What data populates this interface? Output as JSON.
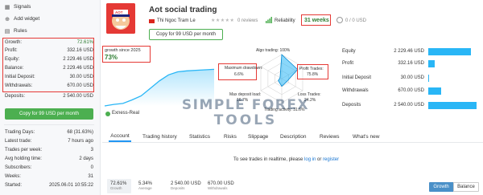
{
  "sidebar": {
    "nav": [
      {
        "label": "Signals",
        "icon": "signal-icon"
      },
      {
        "label": "Add widget",
        "icon": "plus-icon"
      },
      {
        "label": "Rules",
        "icon": "document-icon"
      }
    ],
    "stats": [
      {
        "label": "Growth:",
        "value": "72.61%",
        "color": "#2e7d32"
      },
      {
        "label": "Profit:",
        "value": "332.16 USD"
      },
      {
        "label": "Equity:",
        "value": "2 229.46 USD"
      },
      {
        "label": "Balance:",
        "value": "2 229.46 USD"
      },
      {
        "label": "Initial Deposit:",
        "value": "30.00 USD"
      },
      {
        "label": "Withdrawals:",
        "value": "670.00 USD"
      },
      {
        "label": "Deposits:",
        "value": "2 540.00 USD"
      }
    ],
    "copy_button": "Copy for 99 USD per month",
    "stats2": [
      {
        "label": "Trading Days:",
        "value": "68 (31.63%)"
      },
      {
        "label": "Latest trade:",
        "value": "7 hours ago"
      },
      {
        "label": "Trades per week:",
        "value": "3"
      },
      {
        "label": "Avg holding time:",
        "value": "2 days"
      },
      {
        "label": "Subscribers:",
        "value": "0"
      },
      {
        "label": "Weeks:",
        "value": "31"
      },
      {
        "label": "Started:",
        "value": "2025.06.01 10:55:22"
      }
    ]
  },
  "header": {
    "title": "Aot social trading",
    "author": "Thi Ngoc Tram Le",
    "reviews": "0 reviews",
    "reliability": "Reliability",
    "weeks": "31 weeks",
    "subscribers": "0 / 0 USD",
    "copy_button": "Copy for 99 USD per month",
    "avatar_text": "AOT"
  },
  "chart": {
    "growth_label": "growth since 2025",
    "growth_value": "73%",
    "broker": "Exness-Real",
    "chart_data": {
      "type": "line",
      "series": [
        {
          "values": [
            0,
            3,
            5,
            12,
            20,
            35,
            50,
            62,
            68,
            70,
            71,
            72,
            73
          ]
        }
      ]
    }
  },
  "radar": {
    "algo": "Algo trading: 100%",
    "profit_trades_label": "Profit Trades:",
    "profit_trades_value": "75.8%",
    "loss_trades_label": "Loss Trades:",
    "loss_trades_value": "24.2%",
    "max_drawdown_label": "Maximum drawdown:",
    "max_drawdown_value": "6.6%",
    "max_deposit_label": "Max deposit load:",
    "max_deposit_value": "16.7%",
    "trading_activity": "Trading activity: 31.6%",
    "chart_data": {
      "type": "radar",
      "categories": [
        "Algo trading",
        "Profit Trades",
        "Loss Trades",
        "Trading activity",
        "Max deposit load",
        "Maximum drawdown"
      ],
      "values": [
        100,
        75.8,
        24.2,
        31.6,
        16.7,
        6.6
      ]
    }
  },
  "right_stats": [
    {
      "label": "Equity",
      "value": "2 229.46 USD",
      "fill": 0.88
    },
    {
      "label": "Profit",
      "value": "332.16 USD",
      "fill": 0.13
    },
    {
      "label": "Initial Deposit",
      "value": "30.00 USD",
      "fill": 0.012
    },
    {
      "label": "Withdrawals",
      "value": "670.00 USD",
      "fill": 0.26
    },
    {
      "label": "Deposits",
      "value": "2 540.00 USD",
      "fill": 1.0
    }
  ],
  "watermark": {
    "line1": "SIMPLE FOREX",
    "line2": "TOOLS"
  },
  "tabs": [
    "Account",
    "Trading history",
    "Statistics",
    "Risks",
    "Slippage",
    "Description",
    "Reviews",
    "What's new"
  ],
  "login_msg": {
    "pre": "To see trades in realtime, please ",
    "login": "log in",
    "mid": " or ",
    "register": "register"
  },
  "footer_stats": [
    {
      "value": "72.61%",
      "label": "Growth"
    },
    {
      "value": "5.34%",
      "label": "Average"
    },
    {
      "value": "2 540.00 USD",
      "label": "Deposits"
    },
    {
      "value": "670.00 USD",
      "label": "Withdrawals"
    }
  ],
  "toggle": {
    "growth": "Growth",
    "balance": "Balance"
  },
  "colors": {
    "accent": "#4caf50",
    "bar": "#29b6f6",
    "highlight": "#e53935",
    "link": "#1976d2"
  }
}
